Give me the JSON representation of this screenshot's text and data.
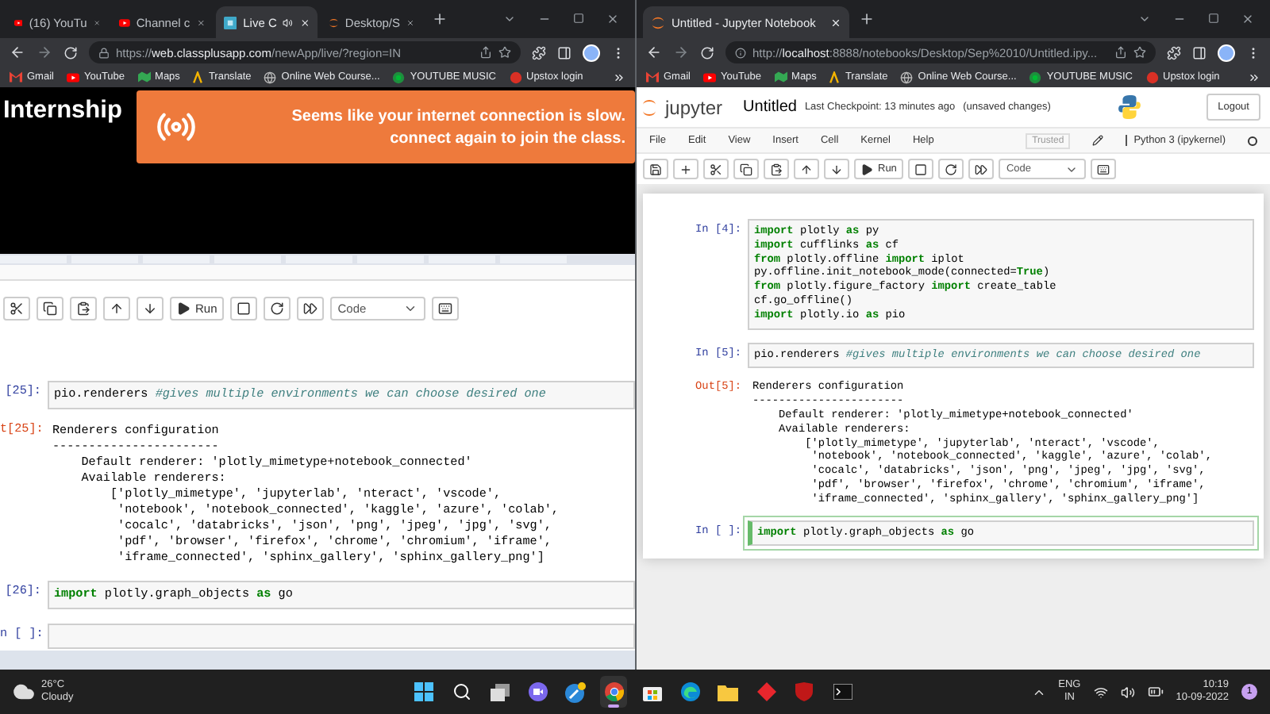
{
  "left_window": {
    "tabs": [
      {
        "title": "(16) YouTu",
        "kind": "youtube",
        "selected": false,
        "audio": false
      },
      {
        "title": "Channel c",
        "kind": "youtube",
        "selected": false,
        "audio": false
      },
      {
        "title": "Live C",
        "kind": "live",
        "selected": true,
        "audio": true
      },
      {
        "title": "Desktop/S",
        "kind": "jupyter",
        "selected": false,
        "audio": false
      }
    ],
    "address": {
      "scheme": "https://",
      "host": "web.classplusapp.com",
      "path": "/newApp/live/?region=IN"
    },
    "bookmarks": [
      {
        "label": "Gmail",
        "kind": "gmail"
      },
      {
        "label": "YouTube",
        "kind": "youtube"
      },
      {
        "label": "Maps",
        "kind": "maps"
      },
      {
        "label": "Translate",
        "kind": "translate"
      },
      {
        "label": "Online Web Course...",
        "kind": "globe"
      },
      {
        "label": "YOUTUBE MUSIC",
        "kind": "music"
      },
      {
        "label": "Upstox login",
        "kind": "upstox"
      }
    ],
    "video": {
      "heading": "Internship",
      "alert_lines": [
        "Seems like your internet connection is slow.",
        "connect again to join the class."
      ]
    },
    "shared_notebook": {
      "toolbar": {
        "run_label": "Run",
        "cell_type": "Code"
      },
      "cells": [
        {
          "kind": "code",
          "prompt": "[25]:",
          "selected": false,
          "lines": [
            [
              {
                "kind": "text",
                "text": "pio.renderers "
              },
              {
                "kind": "comment",
                "text": "#gives multiple environments we can choose desired one"
              }
            ]
          ]
        },
        {
          "kind": "output",
          "prompt": "t[25]:",
          "lines": [
            "Renderers configuration",
            "-----------------------",
            "    Default renderer: 'plotly_mimetype+notebook_connected'",
            "    Available renderers:",
            "        ['plotly_mimetype', 'jupyterlab', 'nteract', 'vscode',",
            "         'notebook', 'notebook_connected', 'kaggle', 'azure', 'colab',",
            "         'cocalc', 'databricks', 'json', 'png', 'jpeg', 'jpg', 'svg',",
            "         'pdf', 'browser', 'firefox', 'chrome', 'chromium', 'iframe',",
            "         'iframe_connected', 'sphinx_gallery', 'sphinx_gallery_png']"
          ]
        },
        {
          "kind": "code",
          "prompt": "[26]:",
          "selected": false,
          "lines": [
            [
              {
                "kind": "keyword",
                "text": "import"
              },
              {
                "kind": "text",
                "text": " plotly.graph_objects "
              },
              {
                "kind": "keyword",
                "text": "as"
              },
              {
                "kind": "text",
                "text": " go"
              }
            ]
          ]
        },
        {
          "kind": "code",
          "prompt": "n [ ]:",
          "selected": false
        }
      ]
    }
  },
  "right_window": {
    "tabs": [
      {
        "title": "Untitled - Jupyter Notebook",
        "kind": "jupyter",
        "selected": true,
        "audio": false
      }
    ],
    "address": {
      "scheme": "http://",
      "host": "localhost",
      "path": ":8888/notebooks/Desktop/Sep%2010/Untitled.ipy..."
    },
    "bookmarks": [
      {
        "label": "Gmail",
        "kind": "gmail"
      },
      {
        "label": "YouTube",
        "kind": "youtube"
      },
      {
        "label": "Maps",
        "kind": "maps"
      },
      {
        "label": "Translate",
        "kind": "translate"
      },
      {
        "label": "Online Web Course...",
        "kind": "globe"
      },
      {
        "label": "YOUTUBE MUSIC",
        "kind": "music"
      },
      {
        "label": "Upstox login",
        "kind": "upstox"
      }
    ],
    "jupyter": {
      "logo_text": "jupyter",
      "notebook_name": "Untitled",
      "checkpoint": "Last Checkpoint: 13 minutes ago",
      "save_status": "(unsaved changes)",
      "logout": "Logout",
      "menu": [
        "File",
        "Edit",
        "View",
        "Insert",
        "Cell",
        "Kernel",
        "Help"
      ],
      "trusted": "Trusted",
      "kernel": "Python 3 (ipykernel)",
      "toolbar": {
        "run_label": "Run",
        "cell_type": "Code"
      },
      "cells": [
        {
          "kind": "code",
          "prompt": "In [4]:",
          "selected": false,
          "lines": [
            [
              {
                "kind": "keyword",
                "text": "import"
              },
              {
                "kind": "text",
                "text": " plotly "
              },
              {
                "kind": "keyword",
                "text": "as"
              },
              {
                "kind": "text",
                "text": " py"
              }
            ],
            [
              {
                "kind": "keyword",
                "text": "import"
              },
              {
                "kind": "text",
                "text": " cufflinks "
              },
              {
                "kind": "keyword",
                "text": "as"
              },
              {
                "kind": "text",
                "text": " cf"
              }
            ],
            [
              {
                "kind": "keyword",
                "text": "from"
              },
              {
                "kind": "text",
                "text": " plotly.offline "
              },
              {
                "kind": "keyword",
                "text": "import"
              },
              {
                "kind": "text",
                "text": " iplot"
              }
            ],
            [
              {
                "kind": "text",
                "text": "py.offline.init_notebook_mode(connected="
              },
              {
                "kind": "keyword",
                "text": "True"
              },
              {
                "kind": "text",
                "text": ")"
              }
            ],
            [
              {
                "kind": "keyword",
                "text": "from"
              },
              {
                "kind": "text",
                "text": " plotly.figure_factory "
              },
              {
                "kind": "keyword",
                "text": "import"
              },
              {
                "kind": "text",
                "text": " create_table"
              }
            ],
            [
              {
                "kind": "text",
                "text": "cf.go_offline()"
              }
            ],
            [
              {
                "kind": "keyword",
                "text": "import"
              },
              {
                "kind": "text",
                "text": " plotly.io "
              },
              {
                "kind": "keyword",
                "text": "as"
              },
              {
                "kind": "text",
                "text": " pio"
              }
            ]
          ]
        },
        {
          "kind": "code",
          "prompt": "In [5]:",
          "selected": false,
          "lines": [
            [
              {
                "kind": "text",
                "text": "pio.renderers "
              },
              {
                "kind": "comment",
                "text": "#gives multiple environments we can choose desired one"
              }
            ]
          ]
        },
        {
          "kind": "output",
          "prompt": "Out[5]:",
          "lines": [
            "Renderers configuration",
            "-----------------------",
            "    Default renderer: 'plotly_mimetype+notebook_connected'",
            "    Available renderers:",
            "        ['plotly_mimetype', 'jupyterlab', 'nteract', 'vscode',",
            "         'notebook', 'notebook_connected', 'kaggle', 'azure', 'colab',",
            "         'cocalc', 'databricks', 'json', 'png', 'jpeg', 'jpg', 'svg',",
            "         'pdf', 'browser', 'firefox', 'chrome', 'chromium', 'iframe',",
            "         'iframe_connected', 'sphinx_gallery', 'sphinx_gallery_png']"
          ]
        },
        {
          "kind": "code",
          "prompt": "In [ ]:",
          "selected": true,
          "lines": [
            [
              {
                "kind": "keyword",
                "text": "import"
              },
              {
                "kind": "text",
                "text": " plotly.graph_objects "
              },
              {
                "kind": "keyword",
                "text": "as"
              },
              {
                "kind": "text",
                "text": " go"
              }
            ]
          ]
        }
      ]
    }
  },
  "taskbar": {
    "temperature": "26°C",
    "weather": "Cloudy",
    "apps": [
      {
        "kind": "start",
        "selected": false
      },
      {
        "kind": "search",
        "selected": false
      },
      {
        "kind": "taskview",
        "selected": false
      },
      {
        "kind": "meet",
        "selected": false
      },
      {
        "kind": "tools",
        "selected": false
      },
      {
        "kind": "chrome",
        "selected": true
      },
      {
        "kind": "store",
        "selected": false
      },
      {
        "kind": "edge",
        "selected": false
      },
      {
        "kind": "folder",
        "selected": false
      },
      {
        "kind": "diamond",
        "selected": false
      },
      {
        "kind": "shield",
        "selected": false
      },
      {
        "kind": "terminal",
        "selected": false
      }
    ],
    "language": "ENG",
    "region": "IN",
    "time": "10:19",
    "date": "10-09-2022",
    "notifications": "1"
  }
}
